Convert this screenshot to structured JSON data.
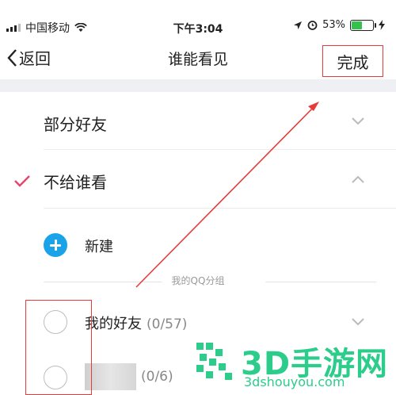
{
  "status_bar": {
    "carrier": "中国移动",
    "time": "下午3:04",
    "battery_percent": "53%",
    "battery_level": 0.53
  },
  "nav": {
    "back_label": "返回",
    "title": "谁能看见",
    "done_label": "完成"
  },
  "options": {
    "partial_friends": "部分好友",
    "not_visible_to": "不给谁看"
  },
  "new_label": "新建",
  "section_title": "我的QQ分组",
  "groups": [
    {
      "name": "我的好友",
      "count": "(0/57)"
    },
    {
      "name": "",
      "count": "(0/6)"
    }
  ],
  "watermark": {
    "text": "3D手游网",
    "url": "3dshouyou.com"
  },
  "colors": {
    "accent": "#1aa3e8",
    "check": "#e6466a",
    "annotation": "#e53b3b",
    "watermark": "#2ccd8b"
  }
}
